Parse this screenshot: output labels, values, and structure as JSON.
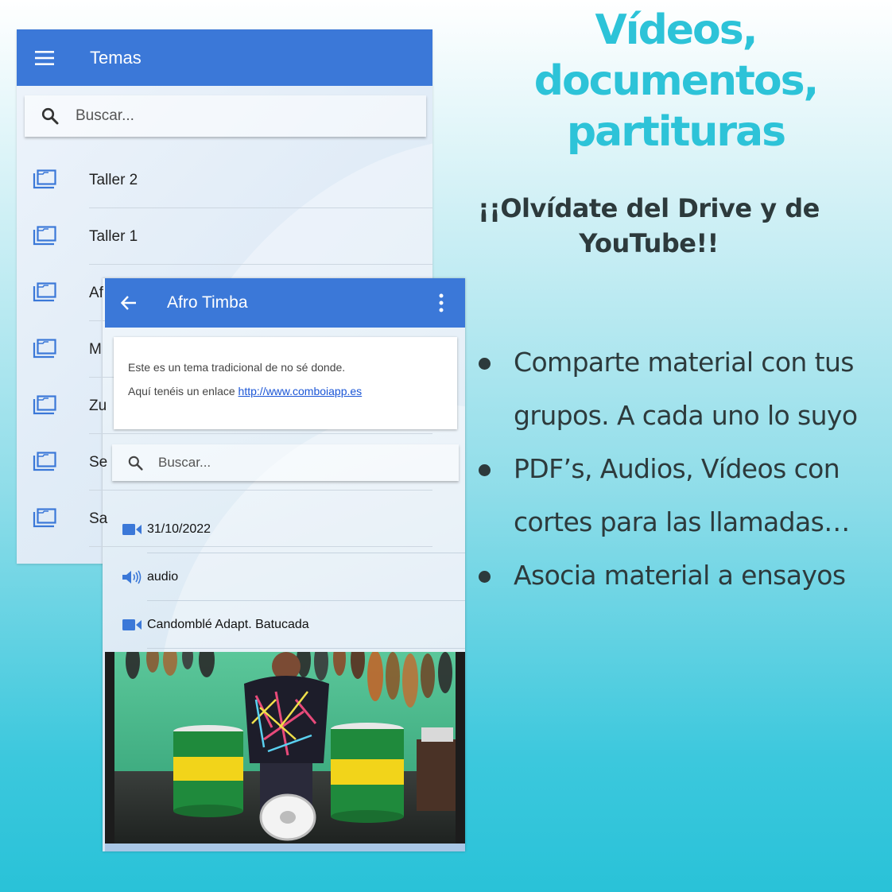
{
  "headline": [
    "Vídeos,",
    "documentos,",
    "partituras"
  ],
  "subheadline": [
    "¡¡Olvídate del Drive y de",
    "YouTube!!"
  ],
  "bullets": [
    "Comparte material con tus grupos. A cada uno lo suyo",
    "PDF’s, Audios, Vídeos con cortes para las llamadas…",
    "Asocia material a ensayos"
  ],
  "colors": {
    "app_bar": "#3b78d8",
    "headline": "#2dc3d8",
    "text": "#2d3a3c",
    "link": "#1a55d6"
  },
  "temas_screen": {
    "title": "Temas",
    "menu_icon": "menu-icon",
    "search_placeholder": "Buscar...",
    "items": [
      {
        "label": "Taller 2",
        "icon": "folder-icon"
      },
      {
        "label": "Taller 1",
        "icon": "folder-icon"
      },
      {
        "label": "Af",
        "icon": "folder-icon"
      },
      {
        "label": "M",
        "icon": "folder-icon"
      },
      {
        "label": "Zu",
        "icon": "folder-icon"
      },
      {
        "label": "Se",
        "icon": "folder-icon"
      },
      {
        "label": "Sa",
        "icon": "folder-icon"
      }
    ]
  },
  "detail_screen": {
    "title": "Afro Timba",
    "back_icon": "arrow-back-icon",
    "more_icon": "more-vert-icon",
    "description_line1": "Este es un tema tradicional de no sé donde.",
    "description_line2_prefix": "Aquí tenéis un enlace ",
    "description_link": "http://www.comboiapp.es",
    "search_placeholder": "Buscar...",
    "items": [
      {
        "label": "31/10/2022",
        "icon": "video-camera-icon"
      },
      {
        "label": "audio",
        "icon": "speaker-icon"
      },
      {
        "label": "Candomblé Adapt. Batucada",
        "icon": "video-camera-icon"
      }
    ]
  }
}
